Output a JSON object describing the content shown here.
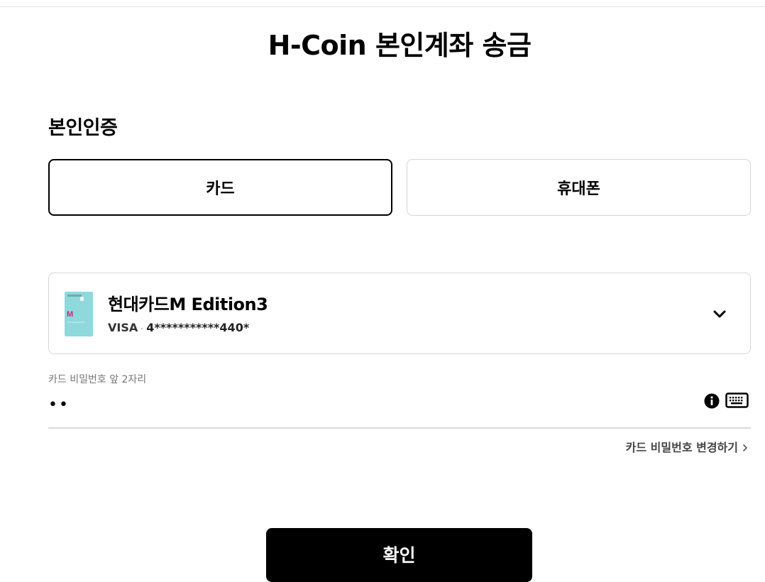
{
  "page": {
    "title": "H-Coin 본인계좌 송금"
  },
  "auth": {
    "section_title": "본인인증",
    "tabs": [
      {
        "label": "카드",
        "selected": true
      },
      {
        "label": "휴대폰",
        "selected": false
      }
    ]
  },
  "card": {
    "name": "현대카드M Edition3",
    "brand": "VISA",
    "masked_number": "4***********440*",
    "card_mark": "M",
    "card_color": "#8fd9dc",
    "dropdown_icon": "chevron-down-icon"
  },
  "password": {
    "label": "카드 비밀번호 앞 2자리",
    "value": "••",
    "info_icon": "info-icon",
    "keypad_icon": "keyboard-icon",
    "change_link": "카드 비밀번호 변경하기"
  },
  "actions": {
    "confirm_label": "확인"
  }
}
